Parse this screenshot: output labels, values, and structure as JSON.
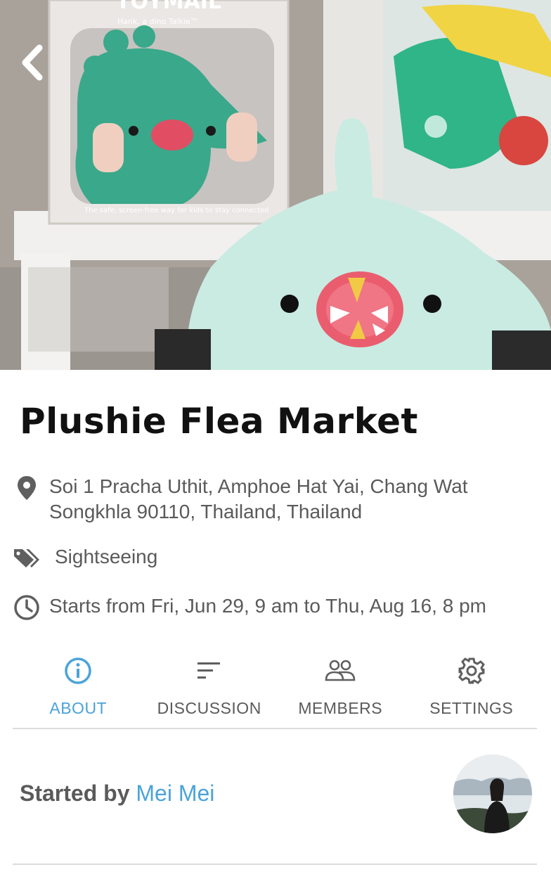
{
  "event": {
    "title": "Plushie Flea Market",
    "location": "Soi 1 Pracha Uthit, Amphoe Hat Yai, Chang Wat Songkhla 90110, Thailand, Thailand",
    "category": "Sightseeing",
    "schedule": "Starts from Fri, Jun 29, 9 am to Thu, Aug 16, 8 pm"
  },
  "hero": {
    "box_brand": "TOYMAIL",
    "box_subtitle": "Hank, a dino Talkie™",
    "box_tagline": "The safe, screen-free way for kids to stay connected",
    "back_icon": "chevron-left-icon"
  },
  "tabs": [
    {
      "label": "ABOUT",
      "icon": "info-icon",
      "active": true
    },
    {
      "label": "DISCUSSION",
      "icon": "sort-lines-icon",
      "active": false
    },
    {
      "label": "MEMBERS",
      "icon": "group-icon",
      "active": false
    },
    {
      "label": "SETTINGS",
      "icon": "gear-icon",
      "active": false
    }
  ],
  "organizer": {
    "prefix": "Started by",
    "name": "Mei Mei"
  },
  "colors": {
    "accent": "#4ba3d9",
    "title": "#111111",
    "text": "#5a5a5a",
    "divider": "#dcdcdc"
  }
}
